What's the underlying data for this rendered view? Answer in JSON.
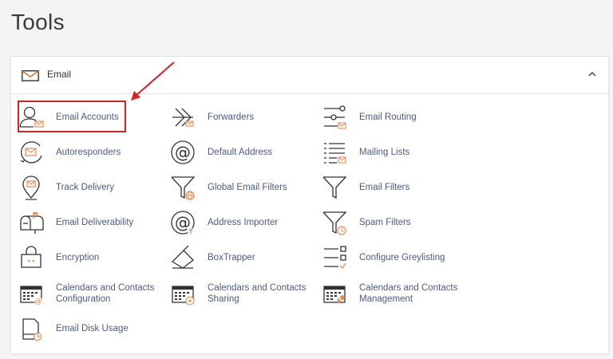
{
  "page": {
    "title": "Tools"
  },
  "panel": {
    "header": {
      "label": "Email"
    },
    "tools": [
      {
        "label": "Email Accounts",
        "icon": "user-mail-icon"
      },
      {
        "label": "Forwarders",
        "icon": "forward-arrow-icon"
      },
      {
        "label": "Email Routing",
        "icon": "routing-icon"
      },
      {
        "label": "Autoresponders",
        "icon": "autoresponder-icon"
      },
      {
        "label": "Default Address",
        "icon": "at-sign-icon"
      },
      {
        "label": "Mailing Lists",
        "icon": "mailing-list-icon"
      },
      {
        "label": "Track Delivery",
        "icon": "location-pin-icon"
      },
      {
        "label": "Global Email Filters",
        "icon": "filter-globe-icon"
      },
      {
        "label": "Email Filters",
        "icon": "filter-icon"
      },
      {
        "label": "Email Deliverability",
        "icon": "mailbox-icon"
      },
      {
        "label": "Address Importer",
        "icon": "at-import-icon"
      },
      {
        "label": "Spam Filters",
        "icon": "filter-clock-icon"
      },
      {
        "label": "Encryption",
        "icon": "lock-icon"
      },
      {
        "label": "BoxTrapper",
        "icon": "box-trap-icon"
      },
      {
        "label": "Configure Greylisting",
        "icon": "greylisting-icon"
      },
      {
        "label": "Calendars and Contacts Configuration",
        "icon": "calendar-at-icon"
      },
      {
        "label": "Calendars and Contacts Sharing",
        "icon": "calendar-share-icon"
      },
      {
        "label": "Calendars and Contacts Management",
        "icon": "calendar-manage-icon"
      },
      {
        "label": "Email Disk Usage",
        "icon": "disk-usage-icon"
      }
    ]
  },
  "colors": {
    "accent": "#f08a4b",
    "link": "#4b5b88",
    "highlight": "#e0201c"
  }
}
